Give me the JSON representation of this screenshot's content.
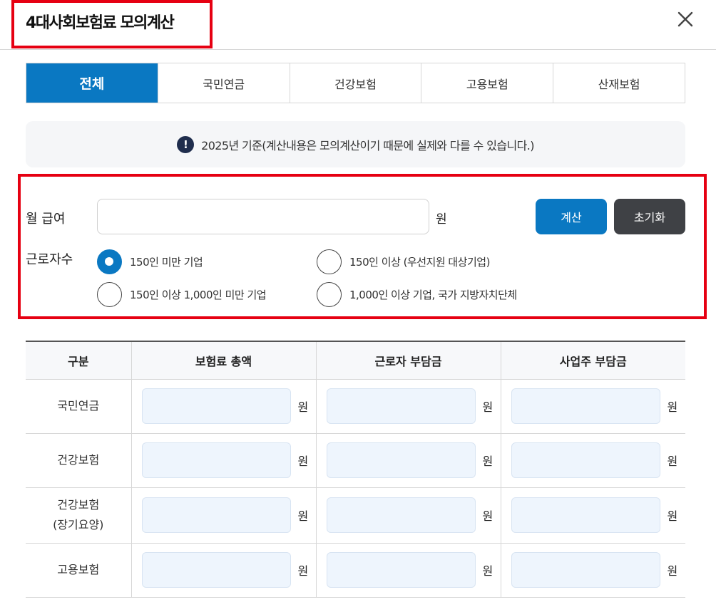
{
  "header": {
    "title": "4대사회보험료 모의계산"
  },
  "tabs": [
    {
      "label": "전체",
      "active": true
    },
    {
      "label": "국민연금",
      "active": false
    },
    {
      "label": "건강보험",
      "active": false
    },
    {
      "label": "고용보험",
      "active": false
    },
    {
      "label": "산재보험",
      "active": false
    }
  ],
  "notice": {
    "text": "2025년 기준(계산내용은 모의계산이기 때문에 실제와 다를 수 있습니다.)",
    "icon": "!"
  },
  "form": {
    "salary_label": "월 급여",
    "salary_value": "",
    "unit": "원",
    "calc_button": "계산",
    "reset_button": "초기화",
    "workers_label": "근로자수",
    "options": [
      {
        "label": "150인 미만 기업",
        "checked": true
      },
      {
        "label": "150인 이상 (우선지원 대상기업)",
        "checked": false
      },
      {
        "label": "150인 이상 1,000인 미만 기업",
        "checked": false
      },
      {
        "label": "1,000인 이상 기업, 국가 지방자치단체",
        "checked": false
      }
    ]
  },
  "table": {
    "headers": [
      "구분",
      "보험료 총액",
      "근로자 부담금",
      "사업주 부담금"
    ],
    "rows": [
      {
        "name_line1": "국민연금",
        "name_line2": ""
      },
      {
        "name_line1": "건강보험",
        "name_line2": ""
      },
      {
        "name_line1": "건강보험",
        "name_line2": "(장기요양)"
      },
      {
        "name_line1": "고용보험",
        "name_line2": ""
      }
    ],
    "unit": "원"
  },
  "colors": {
    "primary": "#0a78c2",
    "dark_button": "#3f4145",
    "highlight_border": "#e60012"
  }
}
